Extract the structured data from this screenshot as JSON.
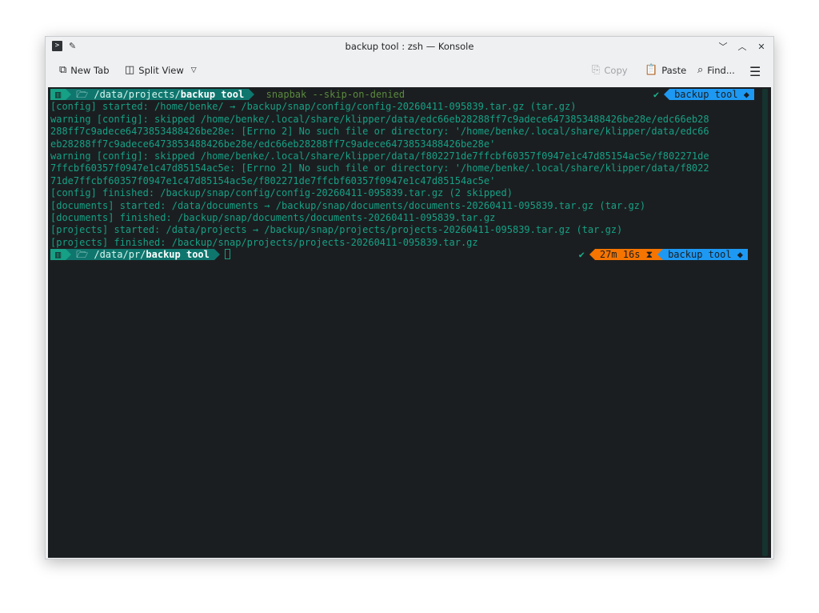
{
  "window": {
    "title": "backup tool : zsh — Konsole",
    "icons": [
      "terminal-icon",
      "pin-icon",
      "minimize-icon",
      "maximize-icon",
      "close-icon"
    ]
  },
  "toolbar": {
    "new_tab": "New Tab",
    "split_view": "Split View",
    "copy": "Copy",
    "paste": "Paste",
    "find": "Find..."
  },
  "prompt1": {
    "os": "▥",
    "dir_icon": "🗁",
    "dir_prefix": "/data/projects/",
    "dir_bold": "backup tool",
    "command": "snapbak --skip-on-denied",
    "check": "✔",
    "context": "backup tool ◆"
  },
  "output": [
    "[config] started: /home/benke/ → /backup/snap/config/config-20260411-095839.tar.gz (tar.gz)",
    "warning [config]: skipped /home/benke/.local/share/klipper/data/edc66eb28288ff7c9adece6473853488426be28e/edc66eb28",
    "288ff7c9adece6473853488426be28e: [Errno 2] No such file or directory: '/home/benke/.local/share/klipper/data/edc66",
    "eb28288ff7c9adece6473853488426be28e/edc66eb28288ff7c9adece6473853488426be28e'",
    "warning [config]: skipped /home/benke/.local/share/klipper/data/f802271de7ffcbf60357f0947e1c47d85154ac5e/f802271de",
    "7ffcbf60357f0947e1c47d85154ac5e: [Errno 2] No such file or directory: '/home/benke/.local/share/klipper/data/f8022",
    "71de7ffcbf60357f0947e1c47d85154ac5e/f802271de7ffcbf60357f0947e1c47d85154ac5e'",
    "[config] finished: /backup/snap/config/config-20260411-095839.tar.gz (2 skipped)",
    "[documents] started: /data/documents → /backup/snap/documents/documents-20260411-095839.tar.gz (tar.gz)",
    "[documents] finished: /backup/snap/documents/documents-20260411-095839.tar.gz",
    "[projects] started: /data/projects → /backup/snap/projects/projects-20260411-095839.tar.gz (tar.gz)",
    "[projects] finished: /backup/snap/projects/projects-20260411-095839.tar.gz"
  ],
  "prompt2": {
    "os": "▥",
    "dir_icon": "🗁",
    "dir_prefix": "/data/",
    "dir_mid": "pr/",
    "dir_bold": "backup tool",
    "check": "✔",
    "elapsed": "27m 16s ⧗",
    "context": "backup tool ◆"
  },
  "colors": {
    "terminal_bg": "#1b1e20",
    "text": "#16a085",
    "time_segment": "#f67400",
    "context_segment": "#1d99f3"
  }
}
